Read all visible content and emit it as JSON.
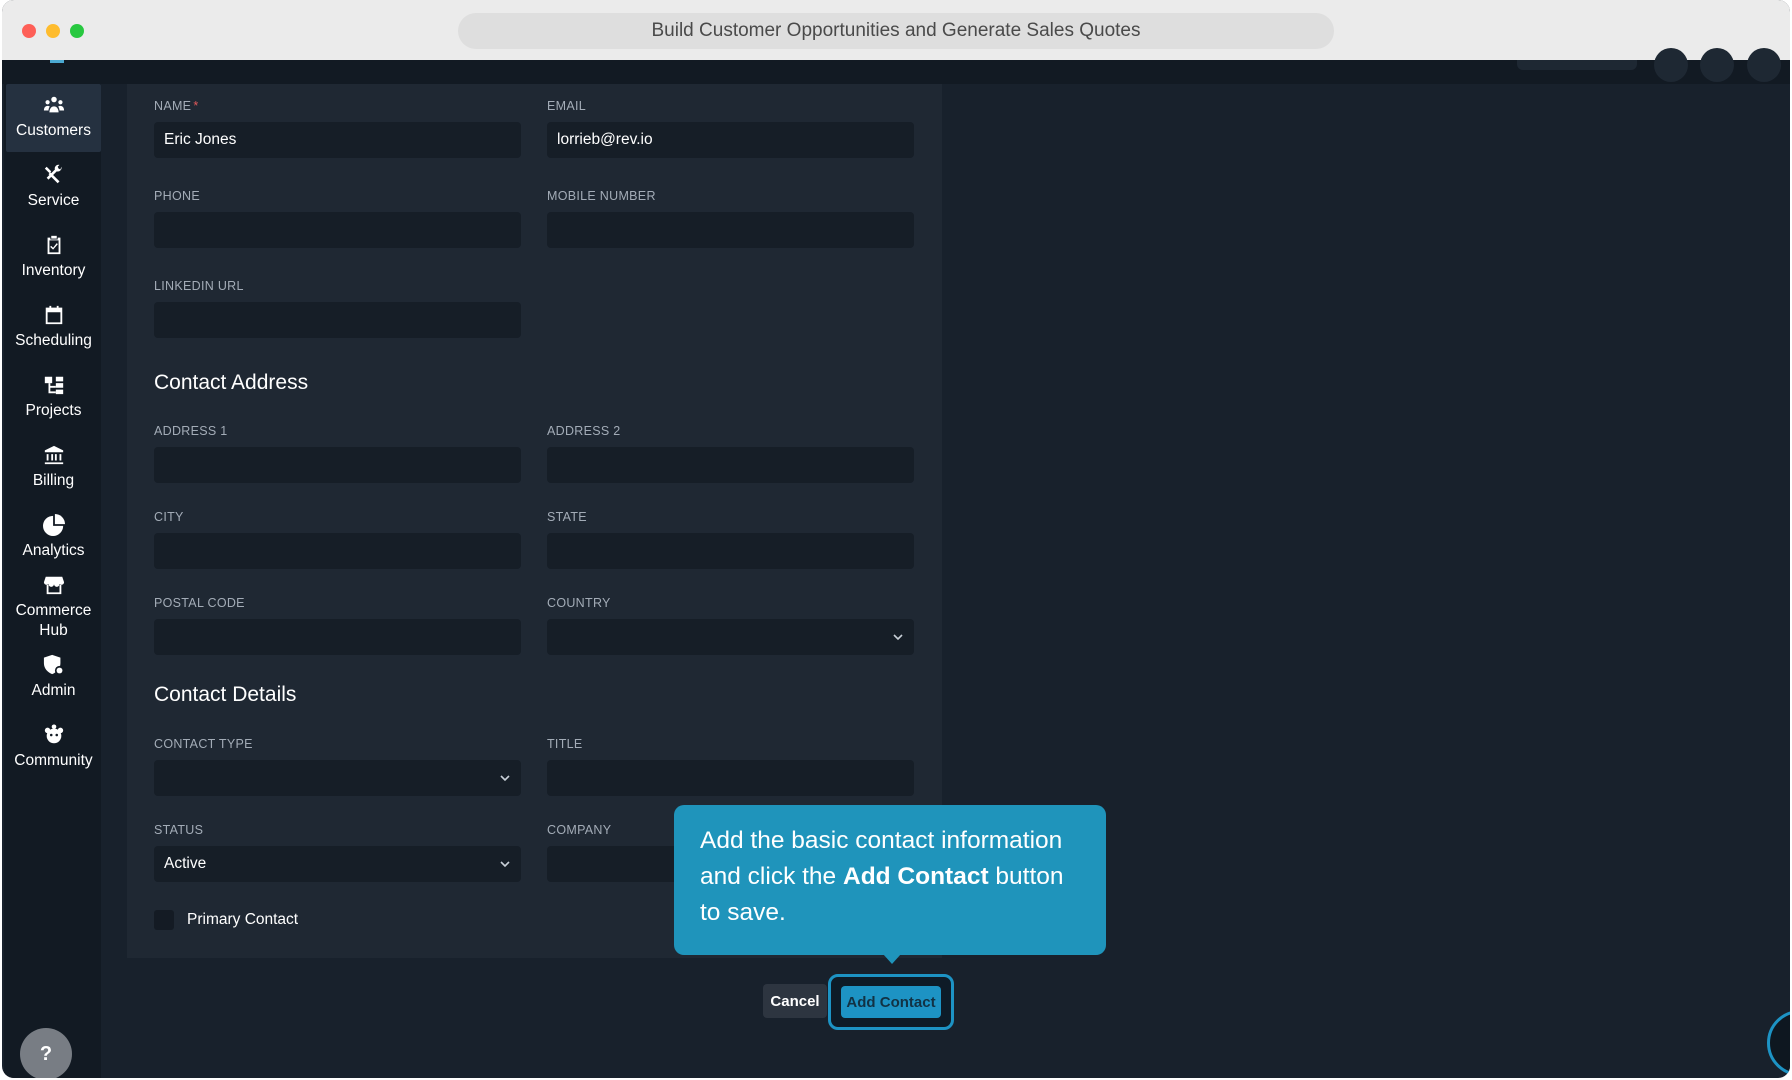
{
  "window": {
    "title": "Build Customer Opportunities and Generate Sales Quotes"
  },
  "sidebar": {
    "items": [
      {
        "label": "Customers",
        "icon": "customers-icon",
        "active": true
      },
      {
        "label": "Service",
        "icon": "service-tools-icon"
      },
      {
        "label": "Inventory",
        "icon": "inventory-clipboard-icon"
      },
      {
        "label": "Scheduling",
        "icon": "calendar-icon"
      },
      {
        "label": "Projects",
        "icon": "projects-hierarchy-icon"
      },
      {
        "label": "Billing",
        "icon": "bank-icon"
      },
      {
        "label": "Analytics",
        "icon": "pie-chart-icon"
      },
      {
        "label": "Commerce Hub",
        "icon": "store-icon"
      },
      {
        "label": "Admin",
        "icon": "admin-shield-icon"
      },
      {
        "label": "Community",
        "icon": "community-icon"
      }
    ],
    "help_label": "?"
  },
  "form": {
    "name": {
      "label": "NAME",
      "required_mark": "*",
      "value": "Eric Jones"
    },
    "email": {
      "label": "EMAIL",
      "value": "lorrieb@rev.io"
    },
    "phone": {
      "label": "PHONE",
      "value": ""
    },
    "mobile": {
      "label": "MOBILE NUMBER",
      "value": ""
    },
    "linkedin": {
      "label": "LINKEDIN URL",
      "value": ""
    },
    "address_section": "Contact Address",
    "address1": {
      "label": "ADDRESS 1",
      "value": ""
    },
    "address2": {
      "label": "ADDRESS 2",
      "value": ""
    },
    "city": {
      "label": "CITY",
      "value": ""
    },
    "state": {
      "label": "STATE",
      "value": ""
    },
    "postal": {
      "label": "POSTAL CODE",
      "value": ""
    },
    "country": {
      "label": "COUNTRY",
      "value": ""
    },
    "details_section": "Contact Details",
    "contact_type": {
      "label": "CONTACT TYPE",
      "value": ""
    },
    "title_field": {
      "label": "TITLE",
      "value": ""
    },
    "status": {
      "label": "STATUS",
      "value": "Active"
    },
    "company": {
      "label": "COMPANY",
      "value": ""
    },
    "primary_contact": {
      "label": "Primary Contact",
      "checked": false
    }
  },
  "actions": {
    "cancel": "Cancel",
    "add_contact": "Add Contact"
  },
  "tooltip": {
    "part1": "Add the basic contact information and click the ",
    "bold": "Add Contact",
    "part2": " button to save."
  },
  "colors": {
    "accent": "#1d93c4",
    "tooltip": "#1f94bb",
    "background": "#18212c",
    "panel": "#1f2833"
  }
}
